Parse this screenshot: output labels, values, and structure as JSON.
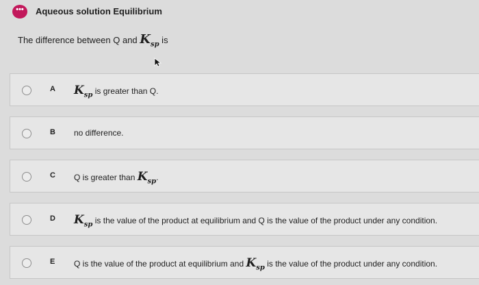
{
  "header": {
    "menu_icon": "dots-icon",
    "menu_glyph": "•••",
    "title": "Aqueous solution Equilibrium"
  },
  "question": {
    "prefix": "The difference between Q and ",
    "ksp_main": "K",
    "ksp_sub": "sp",
    "suffix": " is"
  },
  "options": [
    {
      "letter": "A",
      "text_before": "",
      "ksp_main": "K",
      "ksp_sub": "sp",
      "text_after": " is greater than Q."
    },
    {
      "letter": "B",
      "text": "no difference."
    },
    {
      "letter": "C",
      "text_before": "Q is greater than ",
      "ksp_main": "K",
      "ksp_sub": "sp",
      "text_after": "."
    },
    {
      "letter": "D",
      "text_before": "",
      "ksp_main": "K",
      "ksp_sub": "sp",
      "text_after": " is the value of the product at equilibrium and Q is the value of the product under any condition."
    },
    {
      "letter": "E",
      "text_before": "Q is the value of the product at equilibrium and ",
      "ksp_main": "K",
      "ksp_sub": "sp",
      "text_after": " is the value of the product under any condition."
    }
  ]
}
